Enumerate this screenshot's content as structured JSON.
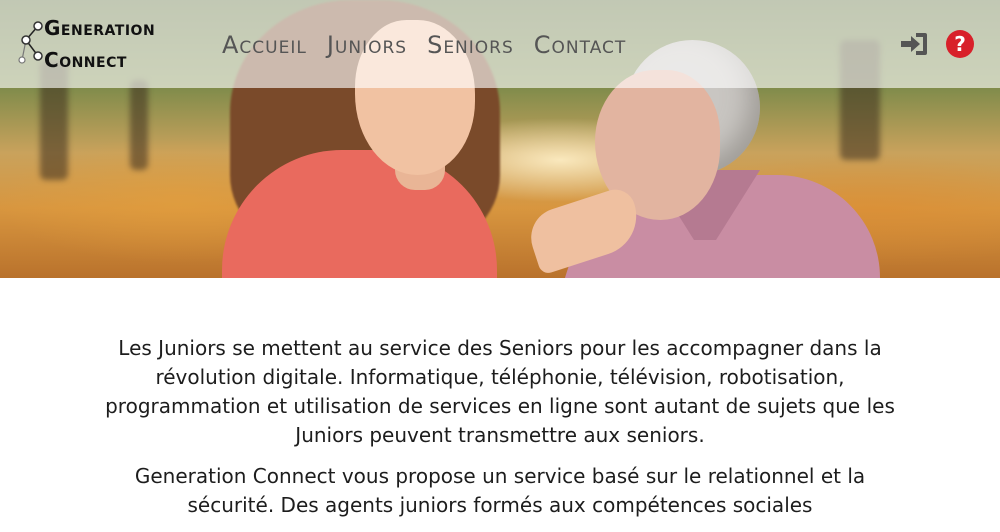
{
  "brand": {
    "line1_initial": "G",
    "line1_rest": "ENERATION",
    "line2_initial": "C",
    "line2_rest": "ONNECT"
  },
  "nav": {
    "items": [
      "Accueil",
      "Juniors",
      "Seniors",
      "Contact"
    ]
  },
  "header_icons": {
    "login": "sign-in-icon",
    "help": "question-circle-icon",
    "help_glyph": "?",
    "help_color": "#d8202a"
  },
  "hero": {
    "image": "junior-and-senior-women-in-park"
  },
  "content": {
    "paragraphs": [
      "Les Juniors se mettent au service des Seniors pour les accompagner dans la révolution digitale. Informatique, téléphonie, télévision, robotisation, programmation et utilisation de services en ligne sont autant de sujets que les Juniors peuvent transmettre aux seniors.",
      "Generation Connect vous propose un service basé sur le relationnel et la sécurité. Des agents juniors formés aux compétences sociales"
    ]
  }
}
